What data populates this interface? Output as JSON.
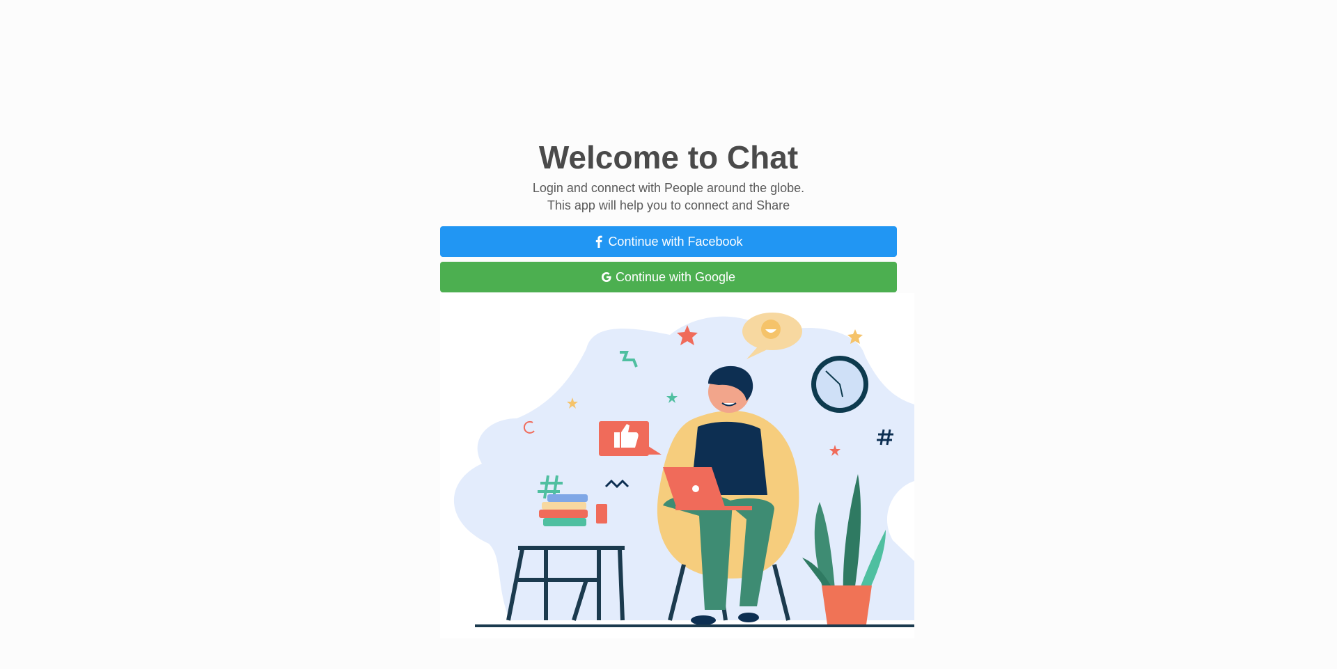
{
  "title": "Welcome to Chat",
  "subtitle": {
    "line1": "Login and connect with People around the globe.",
    "line2": "This app will help you to connect and Share"
  },
  "buttons": {
    "facebook": {
      "label": "Continue with Facebook",
      "icon": "facebook-icon",
      "color": "#2196f3"
    },
    "google": {
      "label": "Continue with Google",
      "icon": "google-icon",
      "color": "#4caf50"
    }
  },
  "colors": {
    "background": "#fcfcfc",
    "title": "#4a4a4a",
    "blob": "#e3ecfc",
    "accent_red": "#f06b5a",
    "accent_teal": "#4fbfa0",
    "navy": "#0d2f52"
  }
}
